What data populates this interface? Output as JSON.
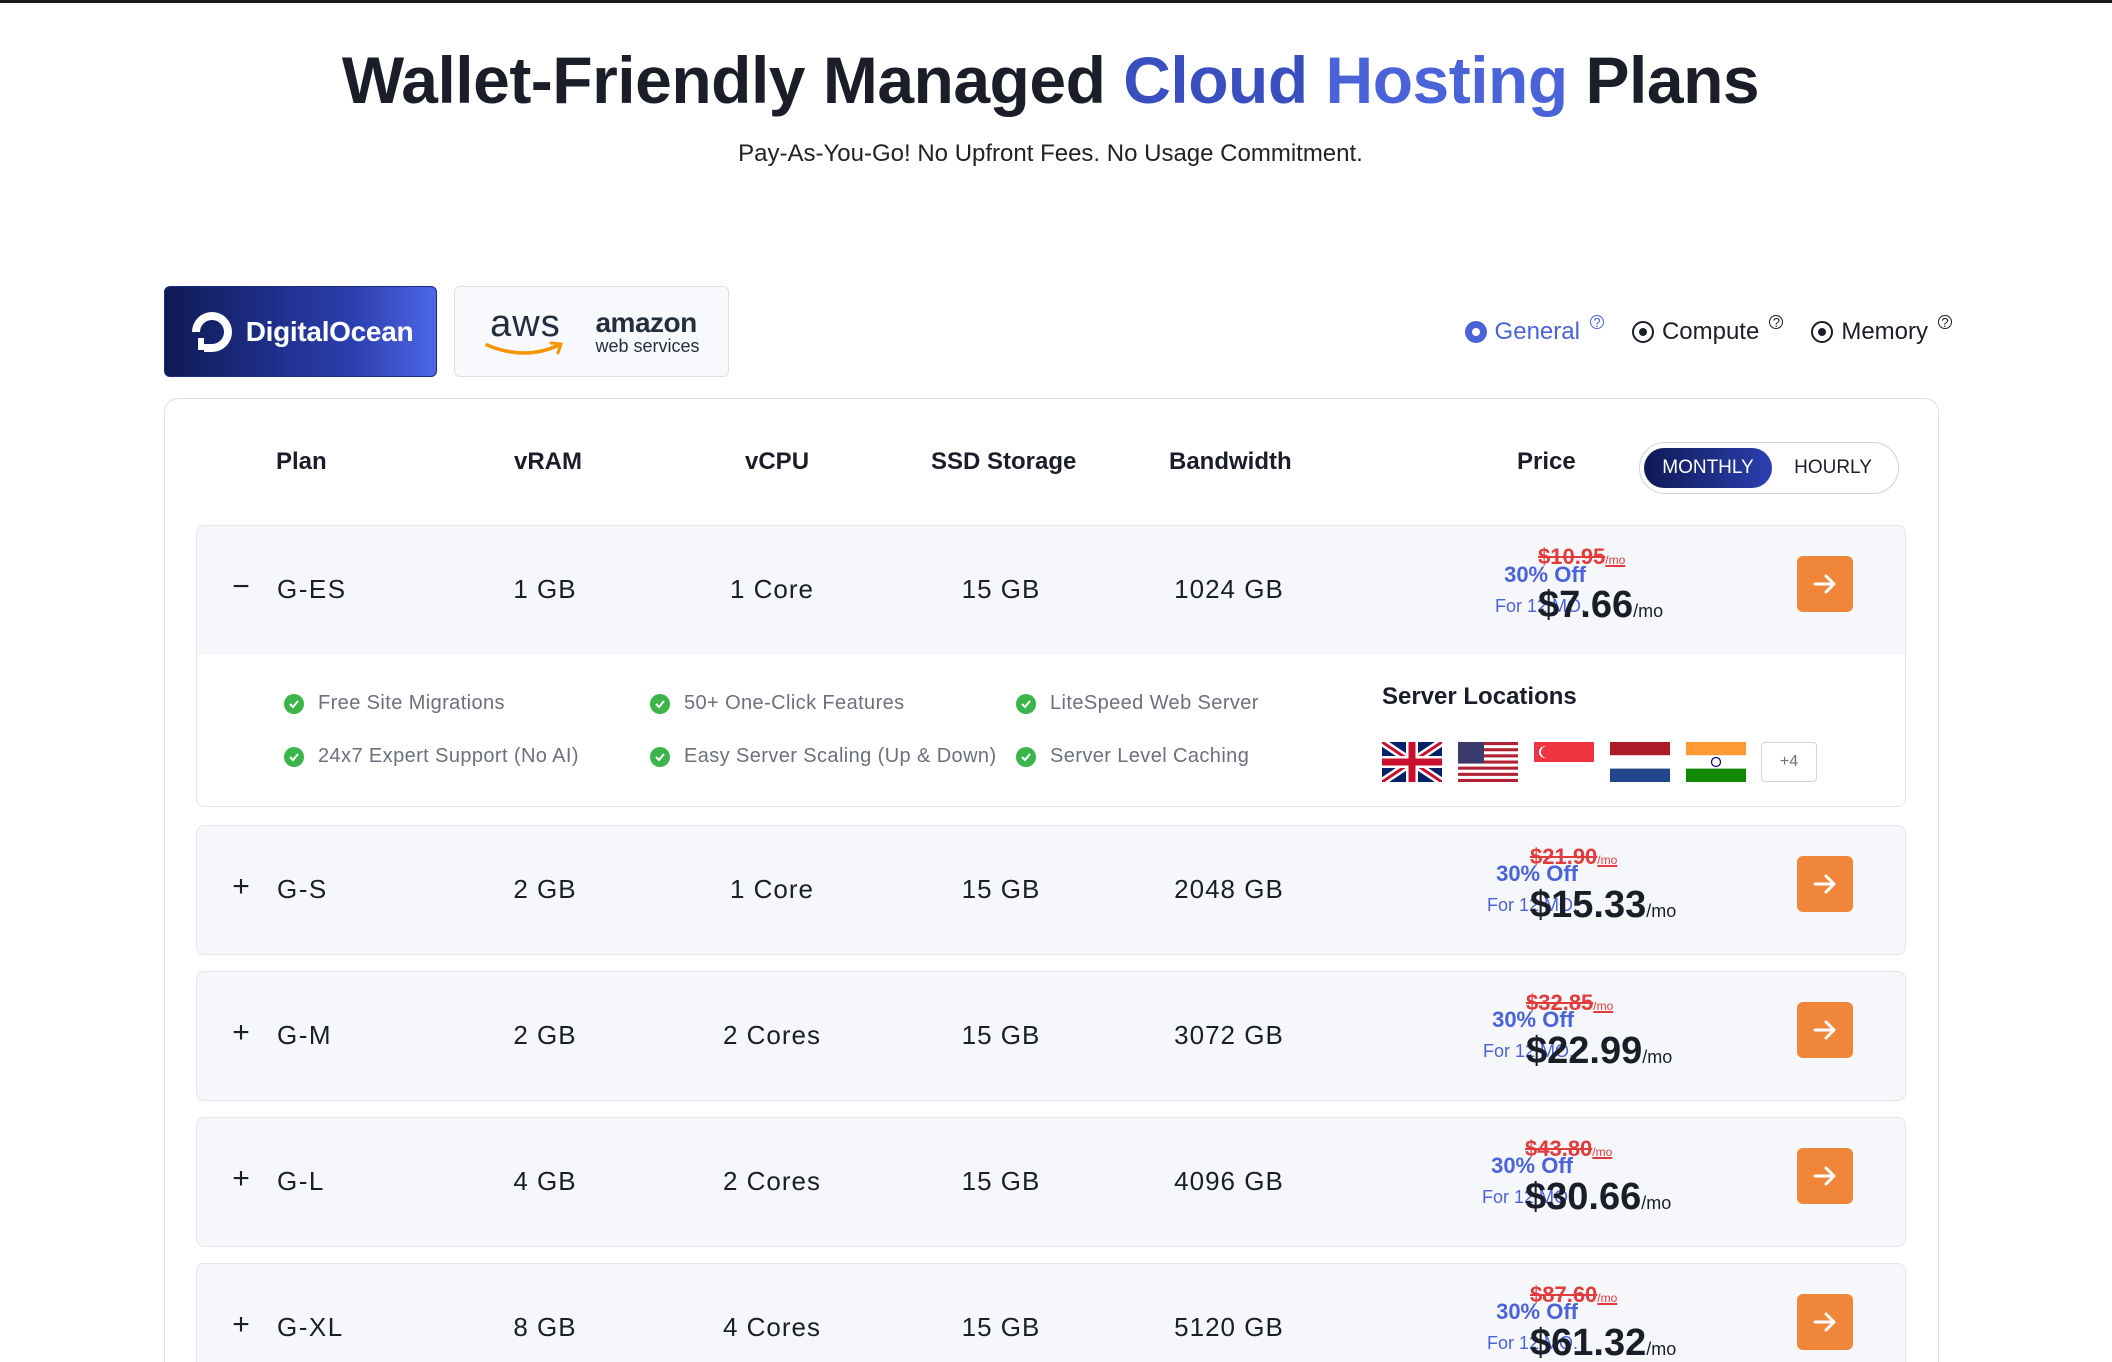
{
  "hero": {
    "title_part1": "Wallet-Friendly",
    "title_part2": "Managed",
    "title_part3": "Cloud",
    "title_part4": "Hosting",
    "title_part5": "Plans",
    "subtitle": "Pay-As-You-Go! No Upfront Fees. No Usage Commitment."
  },
  "providers": {
    "digitalocean": "DigitalOcean",
    "aws_letters": "aws",
    "aws_top": "amazon",
    "aws_bottom": "web services"
  },
  "plan_types": [
    {
      "label": "General",
      "selected": true
    },
    {
      "label": "Compute",
      "selected": false
    },
    {
      "label": "Memory",
      "selected": false
    }
  ],
  "table": {
    "headers": {
      "plan": "Plan",
      "vram": "vRAM",
      "vcpu": "vCPU",
      "storage": "SSD Storage",
      "bandwidth": "Bandwidth",
      "price": "Price"
    },
    "billing": {
      "monthly": "MONTHLY",
      "hourly": "HOURLY",
      "selected": "MONTHLY"
    }
  },
  "plans": [
    {
      "toggle": "−",
      "name": "G-ES",
      "vram": "1 GB",
      "vcpu": "1 Core",
      "storage": "15 GB",
      "bandwidth": "1024 GB",
      "discount": "30% Off",
      "duration": "For 12 MO.",
      "old_price": "$10.95",
      "old_unit": "/mo",
      "price": "$7.66",
      "unit": "/mo",
      "expanded": true
    },
    {
      "toggle": "+",
      "name": "G-S",
      "vram": "2 GB",
      "vcpu": "1 Core",
      "storage": "15 GB",
      "bandwidth": "2048 GB",
      "discount": "30% Off",
      "duration": "For 12 MO.",
      "old_price": "$21.90",
      "old_unit": "/mo",
      "price": "$15.33",
      "unit": "/mo",
      "expanded": false
    },
    {
      "toggle": "+",
      "name": "G-M",
      "vram": "2 GB",
      "vcpu": "2 Cores",
      "storage": "15 GB",
      "bandwidth": "3072 GB",
      "discount": "30% Off",
      "duration": "For 12 MO.",
      "old_price": "$32.85",
      "old_unit": "/mo",
      "price": "$22.99",
      "unit": "/mo",
      "expanded": false
    },
    {
      "toggle": "+",
      "name": "G-L",
      "vram": "4 GB",
      "vcpu": "2 Cores",
      "storage": "15 GB",
      "bandwidth": "4096 GB",
      "discount": "30% Off",
      "duration": "For 12 MO.",
      "old_price": "$43.80",
      "old_unit": "/mo",
      "price": "$30.66",
      "unit": "/mo",
      "expanded": false
    },
    {
      "toggle": "+",
      "name": "G-XL",
      "vram": "8 GB",
      "vcpu": "4 Cores",
      "storage": "15 GB",
      "bandwidth": "5120 GB",
      "discount": "30% Off",
      "duration": "For 12 MO.",
      "old_price": "$87.60",
      "old_unit": "/mo",
      "price": "$61.32",
      "unit": "/mo",
      "expanded": false
    }
  ],
  "features": [
    "Free Site Migrations",
    "50+ One-Click Features",
    "LiteSpeed Web Server",
    "24x7 Expert Support (No AI)",
    "Easy Server Scaling (Up & Down)",
    "Server Level Caching"
  ],
  "locations": {
    "title": "Server Locations",
    "flags": [
      "uk-flag-icon",
      "us-flag-icon",
      "singapore-flag-icon",
      "netherlands-flag-icon",
      "india-flag-icon"
    ],
    "more": "+4"
  },
  "colors": {
    "accent": "#4a63d9",
    "cta": "#f0863a",
    "strike": "#e23b3b",
    "check": "#3bb54a"
  }
}
